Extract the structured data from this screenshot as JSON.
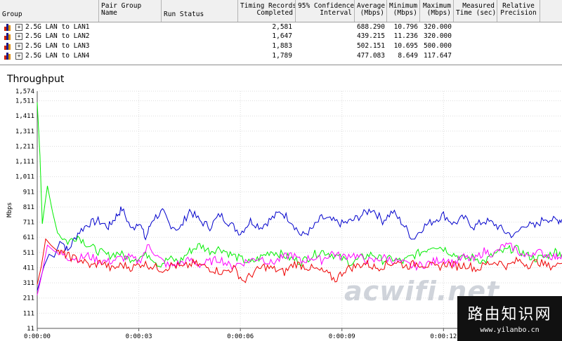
{
  "table": {
    "columns": [
      {
        "label": "Group"
      },
      {
        "label": "Pair Group\nName"
      },
      {
        "label": "Run Status"
      },
      {
        "label": "Timing Records\nCompleted"
      },
      {
        "label": "95% Confidence\nInterval"
      },
      {
        "label": "Average\n(Mbps)"
      },
      {
        "label": "Minimum\n(Mbps)"
      },
      {
        "label": "Maximum\n(Mbps)"
      },
      {
        "label": "Measured\nTime (sec)"
      },
      {
        "label": "Relative\nPrecision"
      }
    ],
    "rows": [
      {
        "group": "2.5G LAN to LAN1",
        "timing_records": "2,581",
        "average": "688.290",
        "minimum": "10.796",
        "maximum": "320.000"
      },
      {
        "group": "2.5G LAN to LAN2",
        "timing_records": "1,647",
        "average": "439.215",
        "minimum": "11.236",
        "maximum": "320.000"
      },
      {
        "group": "2.5G LAN to LAN3",
        "timing_records": "1,883",
        "average": "502.151",
        "minimum": "10.695",
        "maximum": "500.000"
      },
      {
        "group": "2.5G LAN to LAN4",
        "timing_records": "1,789",
        "average": "477.083",
        "minimum": "8.649",
        "maximum": "117.647"
      }
    ],
    "expand_glyph": "+"
  },
  "chart_data": {
    "type": "line",
    "title": "Throughput",
    "ylabel": "Mbps",
    "xlabel": "",
    "ylim": [
      11,
      1574
    ],
    "xlim": [
      0,
      15.5
    ],
    "y_ticks": [
      "1,574",
      "1,511",
      "1,411",
      "1,311",
      "1,211",
      "1,111",
      "1,011",
      "911",
      "811",
      "711",
      "611",
      "511",
      "411",
      "311",
      "211",
      "111",
      "11"
    ],
    "y_tick_values": [
      1574,
      1511,
      1411,
      1311,
      1211,
      1111,
      1011,
      911,
      811,
      711,
      611,
      511,
      411,
      311,
      211,
      111,
      11
    ],
    "x_ticks": [
      "0:00:00",
      "0:00:03",
      "0:00:06",
      "0:00:09",
      "0:00:12"
    ],
    "x_tick_values": [
      0,
      3,
      6,
      9,
      12
    ],
    "grid": true,
    "series": [
      {
        "color": "#0000cc",
        "x": [
          0,
          0.2,
          0.35,
          0.5,
          0.7,
          0.9,
          1.2,
          1.5,
          1.8,
          2.1,
          2.3,
          2.5,
          2.8,
          3.0,
          3.2,
          3.4,
          3.7,
          3.9,
          4.2,
          4.5,
          4.8,
          5.1,
          5.4,
          5.7,
          6.0,
          6.3,
          6.6,
          6.9,
          7.2,
          7.5,
          7.8,
          8.1,
          8.4,
          8.7,
          9.0,
          9.3,
          9.6,
          9.9,
          10.2,
          10.5,
          10.8,
          11.1,
          11.4,
          11.7,
          12.0,
          12.3,
          12.6,
          12.9,
          13.2,
          13.5,
          13.8,
          14.1,
          14.4,
          14.7,
          15.0,
          15.3,
          15.5
        ],
        "y": [
          260,
          420,
          500,
          480,
          600,
          520,
          640,
          700,
          720,
          680,
          740,
          800,
          660,
          720,
          600,
          730,
          780,
          700,
          660,
          790,
          720,
          680,
          760,
          700,
          640,
          720,
          680,
          730,
          780,
          720,
          620,
          660,
          740,
          720,
          700,
          720,
          760,
          800,
          720,
          780,
          700,
          600,
          680,
          720,
          760,
          700,
          740,
          680,
          720,
          700,
          650,
          620,
          700,
          680,
          740,
          720,
          730
        ]
      },
      {
        "color": "#00ee00",
        "x": [
          0,
          0.08,
          0.15,
          0.3,
          0.45,
          0.6,
          0.9,
          1.2,
          1.5,
          1.8,
          2.1,
          2.4,
          2.7,
          3.0,
          3.3,
          3.6,
          3.9,
          4.2,
          4.5,
          4.8,
          5.1,
          5.4,
          5.7,
          6.0,
          6.3,
          6.6,
          6.9,
          7.2,
          7.5,
          7.8,
          8.1,
          8.4,
          8.7,
          9.0,
          9.3,
          9.6,
          9.9,
          10.2,
          10.5,
          10.8,
          11.1,
          11.4,
          11.7,
          12.0,
          12.3,
          12.6,
          12.9,
          13.2,
          13.5,
          13.8,
          14.1,
          14.4,
          14.7,
          15.0,
          15.3,
          15.5
        ],
        "y": [
          1500,
          1150,
          700,
          950,
          780,
          640,
          580,
          620,
          560,
          520,
          490,
          510,
          470,
          480,
          500,
          430,
          470,
          450,
          520,
          560,
          520,
          540,
          500,
          470,
          440,
          480,
          520,
          500,
          470,
          450,
          490,
          520,
          500,
          470,
          440,
          480,
          500,
          460,
          470,
          450,
          490,
          520,
          560,
          540,
          500,
          470,
          480,
          450,
          500,
          520,
          540,
          500,
          470,
          480,
          520,
          500
        ]
      },
      {
        "color": "#ff00ff",
        "x": [
          0,
          0.15,
          0.3,
          0.5,
          0.7,
          0.9,
          1.2,
          1.5,
          1.8,
          2.1,
          2.4,
          2.7,
          3.0,
          3.3,
          3.6,
          3.9,
          4.2,
          4.5,
          4.8,
          5.1,
          5.4,
          5.7,
          6.0,
          6.3,
          6.6,
          6.9,
          7.2,
          7.5,
          7.8,
          8.1,
          8.4,
          8.7,
          9.0,
          9.3,
          9.6,
          9.9,
          10.2,
          10.5,
          10.8,
          11.1,
          11.4,
          11.7,
          12.0,
          12.3,
          12.6,
          12.9,
          13.2,
          13.5,
          13.8,
          14.1,
          14.4,
          14.7,
          15.0,
          15.3,
          15.5
        ],
        "y": [
          230,
          380,
          560,
          520,
          500,
          480,
          470,
          490,
          460,
          450,
          470,
          480,
          450,
          560,
          470,
          420,
          440,
          460,
          430,
          450,
          470,
          420,
          440,
          460,
          480,
          440,
          470,
          500,
          450,
          480,
          460,
          510,
          480,
          500,
          470,
          450,
          480,
          460,
          440,
          420,
          430,
          450,
          470,
          440,
          480,
          460,
          520,
          500,
          560,
          540,
          480,
          520,
          500,
          480,
          500
        ]
      },
      {
        "color": "#ee0000",
        "x": [
          0,
          0.12,
          0.25,
          0.4,
          0.6,
          0.8,
          1.0,
          1.3,
          1.6,
          1.9,
          2.2,
          2.5,
          2.8,
          3.1,
          3.4,
          3.7,
          4.0,
          4.3,
          4.6,
          4.9,
          5.2,
          5.5,
          5.8,
          6.1,
          6.4,
          6.7,
          7.0,
          7.3,
          7.6,
          7.9,
          8.2,
          8.5,
          8.8,
          9.1,
          9.4,
          9.7,
          10.0,
          10.3,
          10.6,
          10.9,
          11.2,
          11.5,
          11.8,
          12.1,
          12.4,
          12.7,
          13.0,
          13.3,
          13.6,
          13.9,
          14.2,
          14.5,
          14.8,
          15.1,
          15.5
        ],
        "y": [
          300,
          420,
          600,
          560,
          520,
          500,
          480,
          460,
          420,
          450,
          400,
          430,
          410,
          440,
          420,
          400,
          430,
          410,
          440,
          420,
          400,
          380,
          410,
          320,
          380,
          420,
          400,
          380,
          440,
          420,
          400,
          380,
          330,
          400,
          420,
          440,
          410,
          430,
          450,
          420,
          440,
          430,
          410,
          440,
          420,
          430,
          400,
          440,
          450,
          420,
          460,
          430,
          450,
          420,
          440
        ]
      }
    ]
  },
  "watermark": {
    "site_logo": "acwifi.net",
    "brand_cn": "路由知识网",
    "brand_url": "www.yilanbo.cn"
  },
  "colors": {
    "lan1": "#0000cc",
    "lan2": "#ee0000",
    "lan3": "#00ee00",
    "lan4": "#ff00ff",
    "grid": "#dddddd",
    "axis": "#555555"
  }
}
